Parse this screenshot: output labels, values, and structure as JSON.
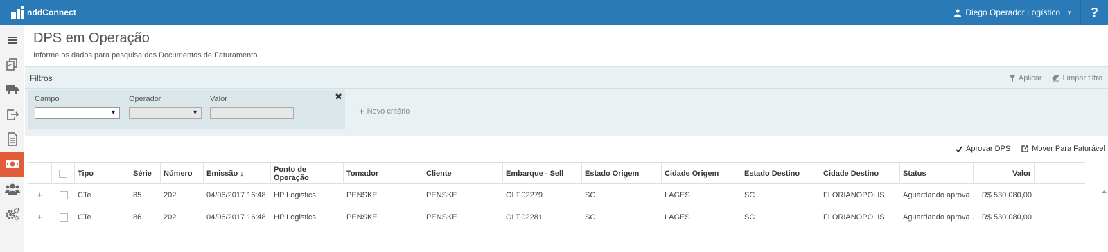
{
  "app": {
    "name": "nddConnect"
  },
  "header": {
    "user_name": "Diego Operador Logístico",
    "help_label": "?"
  },
  "sidebar": {
    "items": [
      {
        "icon": "menu-icon"
      },
      {
        "icon": "documents-icon"
      },
      {
        "icon": "truck-icon"
      },
      {
        "icon": "export-icon"
      },
      {
        "icon": "file-icon"
      },
      {
        "icon": "money-icon",
        "active": true
      },
      {
        "icon": "users-icon"
      },
      {
        "icon": "gears-icon"
      }
    ]
  },
  "page": {
    "title": "DPS em Operação",
    "subtitle": "Informe os dados para pesquisa dos Documentos de Faturamento"
  },
  "filters": {
    "title": "Filtros",
    "apply_label": "Aplicar",
    "clear_label": "Limpar filtro",
    "field_label": "Campo",
    "operator_label": "Operador",
    "value_label": "Valor",
    "field_value": "",
    "operator_value": "",
    "value_value": "",
    "new_criteria_label": "Novo critério"
  },
  "toolbar": {
    "approve_label": "Aprovar DPS",
    "move_label": "Mover Para Faturável"
  },
  "table": {
    "columns": [
      "Tipo",
      "Série",
      "Número",
      "Emissão ↓",
      "Ponto de Operação",
      "Tomador",
      "Cliente",
      "Embarque - Sell",
      "Estado Origem",
      "Cidade Origem",
      "Estado Destino",
      "Cidade Destino",
      "Status",
      "Valor"
    ],
    "rows": [
      [
        "CTe",
        "85",
        "202",
        "04/06/2017 16:48",
        "HP Logistics",
        "PENSKE",
        "PENSKE",
        "OLT.02279",
        "SC",
        "LAGES",
        "SC",
        "FLORIANOPOLIS",
        "Aguardando aprova...",
        "R$ 530.080,00"
      ],
      [
        "CTe",
        "86",
        "202",
        "04/06/2017 16:48",
        "HP Logistics",
        "PENSKE",
        "PENSKE",
        "OLT.02281",
        "SC",
        "LAGES",
        "SC",
        "FLORIANOPOLIS",
        "Aguardando aprova...",
        "R$ 530.080,00"
      ]
    ]
  },
  "colors": {
    "header": "#2a7ab8",
    "active_sidebar": "#e25c3a",
    "filter_band": "#e9f1f3"
  }
}
